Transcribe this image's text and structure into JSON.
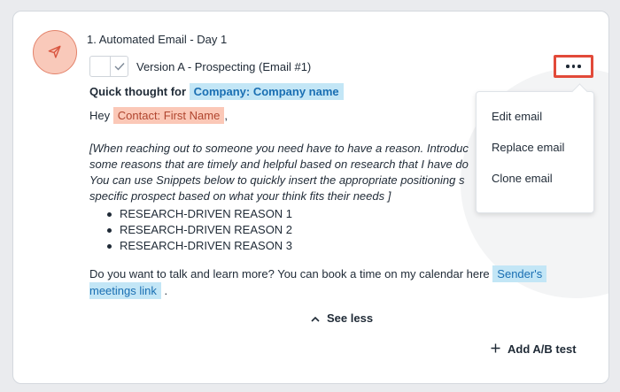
{
  "step": {
    "title": "1. Automated Email - Day 1",
    "version_label": "Version A - Prospecting (Email #1)"
  },
  "email": {
    "subject_prefix": "Quick thought for",
    "subject_token": "Company: Company name",
    "greeting": "Hey",
    "greeting_token": "Contact: First Name",
    "greeting_suffix": ",",
    "guide_lines": [
      "[When reaching out to someone you need have to have a reason. Introduc",
      "some reasons that are timely and helpful based on research that I have do",
      "You can use Snippets below to quickly insert the appropriate positioning s",
      "specific prospect based on what your think fits their needs ]"
    ],
    "bullets": [
      "RESEARCH-DRIVEN REASON 1",
      "RESEARCH-DRIVEN REASON 2",
      "RESEARCH-DRIVEN REASON 3"
    ],
    "closing": "Do you want to talk and learn more? You can book a time on my calendar here",
    "closing_token_line1": "Sender's",
    "closing_token_line2": "meetings link",
    "closing_suffix": "."
  },
  "actions": {
    "see_less": "See less",
    "add_ab_test": "Add A/B test"
  },
  "menu": {
    "items": [
      "Edit email",
      "Replace email",
      "Clone email"
    ]
  },
  "icons": {
    "avatar": "paper-plane-icon",
    "more": "more-dots-icon",
    "check": "checkmark-icon",
    "see_less": "chevron-up-icon",
    "add": "plus-icon"
  },
  "colors": {
    "avatar_bg": "#f9c9ba",
    "highlight_border": "#e24a39",
    "token_blue_bg": "#c3e6f6",
    "token_orange_bg": "#fbc8b7"
  }
}
